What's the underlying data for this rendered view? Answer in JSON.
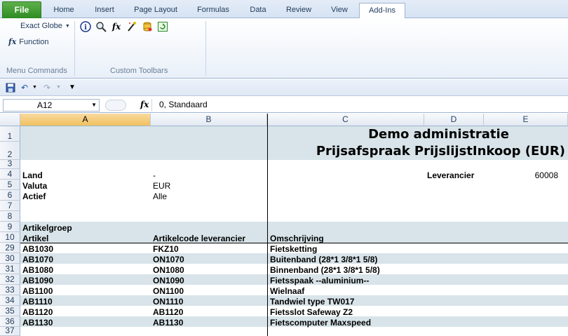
{
  "ribbon": {
    "tabs": [
      "File",
      "Home",
      "Insert",
      "Page Layout",
      "Formulas",
      "Data",
      "Review",
      "View",
      "Add-Ins"
    ],
    "active_tab": "Add-Ins",
    "menu_commands": {
      "items": [
        "Exact Globe",
        "Function"
      ],
      "group_label": "Menu Commands"
    },
    "custom_toolbars": {
      "group_label": "Custom Toolbars",
      "icons": [
        "info-icon",
        "zoom-icon",
        "fx-icon",
        "wand-icon",
        "database-icon",
        "refresh-icon"
      ]
    }
  },
  "formula_bar": {
    "name_box": "A12",
    "fx": "fx",
    "formula": "0, Standaard"
  },
  "columns": [
    "A",
    "B",
    "C",
    "D",
    "E"
  ],
  "selected": {
    "column": "A",
    "row": "12"
  },
  "rows": [
    "1",
    "2",
    "3",
    "4",
    "5",
    "6",
    "7",
    "8",
    "9",
    "10",
    "29",
    "30",
    "31",
    "32",
    "33",
    "34",
    "35",
    "36",
    "37"
  ],
  "sheet": {
    "title1": "Demo administratie",
    "title2": "Prijsafspraak PrijslijstInkoop (EUR)",
    "land_label": "Land",
    "land_value": "-",
    "valuta_label": "Valuta",
    "valuta_value": "EUR",
    "actief_label": "Actief",
    "actief_value": "Alle",
    "leverancier_label": "Leverancier",
    "leverancier_value": "60008",
    "group_header": "Artikelgroep",
    "headers": [
      "Artikel",
      "Artikelcode leverancier",
      "Omschrijving"
    ],
    "items": [
      {
        "row": "29",
        "artikel": "AB1030",
        "code": "FKZ10",
        "omschrijving": "Fietsketting"
      },
      {
        "row": "30",
        "artikel": "AB1070",
        "code": "ON1070",
        "omschrijving": "Buitenband (28*1 3/8*1 5/8)"
      },
      {
        "row": "31",
        "artikel": "AB1080",
        "code": "ON1080",
        "omschrijving": "Binnenband (28*1 3/8*1 5/8)"
      },
      {
        "row": "32",
        "artikel": "AB1090",
        "code": "ON1090",
        "omschrijving": "Fietsspaak --aluminium--"
      },
      {
        "row": "33",
        "artikel": "AB1100",
        "code": "ON1100",
        "omschrijving": "Wielnaaf"
      },
      {
        "row": "34",
        "artikel": "AB1110",
        "code": "ON1110",
        "omschrijving": "Tandwiel type TW017"
      },
      {
        "row": "35",
        "artikel": "AB1120",
        "code": "AB1120",
        "omschrijving": "Fietsslot Safeway Z2"
      },
      {
        "row": "36",
        "artikel": "AB1130",
        "code": "AB1130",
        "omschrijving": "Fietscomputer Maxspeed"
      }
    ]
  },
  "colors": {
    "band": "#d8e4e9",
    "selection": "#f1c15f",
    "file_tab": "#2e8b23"
  }
}
